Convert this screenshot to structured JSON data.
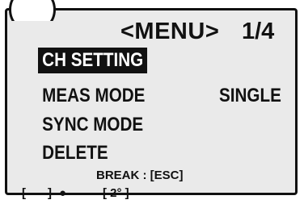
{
  "header": {
    "title": "<MENU>",
    "page_indicator": "1/4"
  },
  "menu": {
    "items": [
      {
        "label": "CH SETTING",
        "selected": true
      },
      {
        "label": "MEAS MODE",
        "value": "SINGLE"
      },
      {
        "label": "SYNC MODE"
      },
      {
        "label": "DELETE"
      }
    ]
  },
  "footer": {
    "break_hint": "BREAK : [ESC]",
    "status_bracket_left": "[",
    "status_bracket_right": "]",
    "status_dot": "●",
    "status_angle": "[ 2° ]"
  }
}
